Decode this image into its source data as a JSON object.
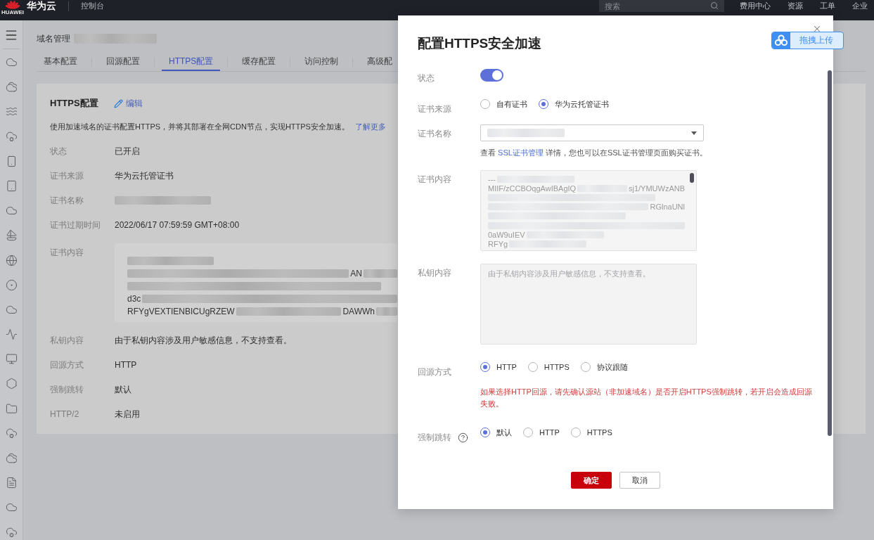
{
  "top_bar": {
    "logo_text": "HUAWEI",
    "brand": "华为云",
    "console": "控制台",
    "search": {
      "placeholder": "搜索"
    },
    "links": [
      "费用中心",
      "资源",
      "工单",
      "企业"
    ]
  },
  "page": {
    "title": "域名管理"
  },
  "tabs": [
    {
      "label": "基本配置",
      "selected": false
    },
    {
      "label": "回源配置",
      "selected": false
    },
    {
      "label": "HTTPS配置",
      "selected": true
    },
    {
      "label": "缓存配置",
      "selected": false
    },
    {
      "label": "访问控制",
      "selected": false
    },
    {
      "label": "高级配",
      "selected": false
    }
  ],
  "card": {
    "title": "HTTPS配置",
    "edit": "编辑",
    "description": "使用加速域名的证书配置HTTPS，并将其部署在全网CDN节点，实现HTTPS安全加速。",
    "learn_more": "了解更多",
    "fields": [
      {
        "kind": "text",
        "label": "状态",
        "value": "已开启"
      },
      {
        "kind": "text",
        "label": "证书来源",
        "value": "华为云托管证书"
      },
      {
        "kind": "redacted",
        "label": "证书名称"
      },
      {
        "kind": "text",
        "label": "证书过期时间",
        "value": "2022/06/17 07:59:59 GMT+08:00"
      },
      {
        "kind": "certificate",
        "label": "证书内容",
        "lines": [
          {
            "kind": "blurred"
          },
          {
            "kind": "tail",
            "tail": "AN"
          },
          {
            "kind": "blurred"
          },
          {
            "kind": "lead",
            "text": "d3c"
          },
          {
            "kind": "both",
            "text": "RFYgVEXTIENBICUgRZEW",
            "tail": "DAWWh"
          }
        ]
      },
      {
        "kind": "text",
        "label": "私钥内容",
        "value": "由于私钥内容涉及用户敏感信息，不支持查看。"
      },
      {
        "kind": "text",
        "label": "回源方式",
        "value": "HTTP"
      },
      {
        "kind": "text",
        "label": "强制跳转",
        "value": "默认"
      },
      {
        "kind": "text",
        "label": "HTTP/2",
        "value": "未启用"
      }
    ]
  },
  "dialog": {
    "title": "配置HTTPS安全加速",
    "fields": [
      {
        "kind": "switch",
        "label": "状态",
        "on": true
      },
      {
        "kind": "radio",
        "label": "证书来源",
        "options": [
          {
            "label": "自有证书",
            "selected": false
          },
          {
            "label": "华为云托管证书",
            "selected": true
          }
        ]
      },
      {
        "kind": "select",
        "label": "证书名称",
        "help": {
          "before": "查看",
          "link": "SSL证书管理",
          "after": "详情，您也可以在SSL证书管理页面购买证书。"
        }
      },
      {
        "kind": "certificate",
        "label": "证书内容",
        "lines": [
          {
            "kind": "lead",
            "text": "---"
          },
          {
            "kind": "both",
            "text": "MIIF/zCCBOqgAwIBAgIQ",
            "tail": "sj1/YMUWzANB"
          },
          {
            "kind": "blurred"
          },
          {
            "kind": "tail",
            "tail": "RGlnaUNl"
          },
          {
            "kind": "blurred"
          },
          {
            "kind": "blurred"
          },
          {
            "kind": "lead",
            "text": "0aW9uIEV"
          },
          {
            "kind": "lead",
            "text": "RFYg"
          }
        ]
      },
      {
        "kind": "textarea",
        "label": "私钥内容",
        "placeholder": "由于私钥内容涉及用户敏感信息，不支持查看。",
        "disabled": true
      },
      {
        "kind": "radio",
        "label": "回源方式",
        "options": [
          {
            "label": "HTTP",
            "selected": true
          },
          {
            "label": "HTTPS",
            "selected": false
          },
          {
            "label": "协议跟随",
            "selected": false
          }
        ],
        "warning": "如果选择HTTP回源，请先确认源站（非加速域名）是否开启HTTPS强制跳转，若开启会造成回源失败。"
      },
      {
        "kind": "radio",
        "label": "强制跳转",
        "help_icon": true,
        "options": [
          {
            "label": "默认",
            "selected": true
          },
          {
            "label": "HTTP",
            "selected": false
          },
          {
            "label": "HTTPS",
            "selected": false
          }
        ]
      }
    ],
    "buttons": [
      {
        "kind": "primary",
        "label": "确定"
      },
      {
        "kind": "secondary",
        "label": "取消"
      }
    ]
  },
  "upload_widget": {
    "label": "拖拽上传"
  }
}
